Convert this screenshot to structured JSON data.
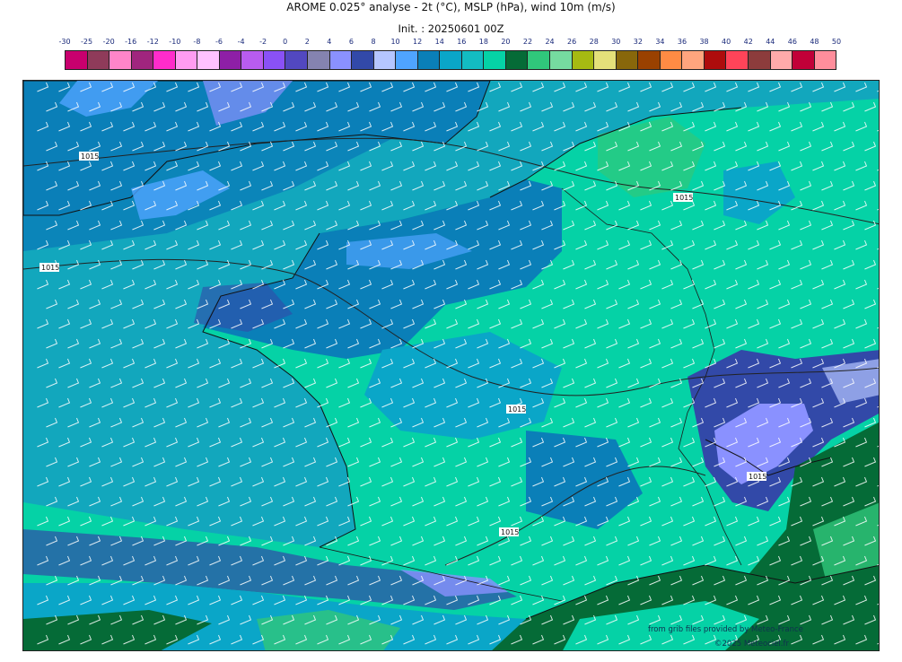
{
  "header": {
    "title": "AROME 0.025° analyse - 2t (°C), MSLP (hPa), wind 10m (m/s)",
    "init": "Init. : 20250601 00Z"
  },
  "legend": {
    "ticks": [
      "-30",
      "-25",
      "-20",
      "-16",
      "-12",
      "-10",
      "-8",
      "-6",
      "-4",
      "-2",
      "0",
      "2",
      "4",
      "6",
      "8",
      "10",
      "12",
      "14",
      "16",
      "18",
      "20",
      "22",
      "24",
      "26",
      "28",
      "30",
      "32",
      "34",
      "36",
      "38",
      "40",
      "42",
      "44",
      "46",
      "48",
      "50"
    ],
    "colors": [
      "#c8006e",
      "#8f3b5a",
      "#ff85c9",
      "#a0257e",
      "#ff2ccb",
      "#ff9cf1",
      "#ffc2ff",
      "#8e1fa6",
      "#b85cf0",
      "#8a51f6",
      "#5248c0",
      "#8583b0",
      "#8a91ff",
      "#3249a8",
      "#b5c6ff",
      "#4fa4ff",
      "#0a7fb8",
      "#0aa6c8",
      "#13bcc2",
      "#05d2a6",
      "#056b37",
      "#30c77b",
      "#76dba0",
      "#a6ba12",
      "#e4e07a",
      "#88670b",
      "#9a4100",
      "#ff8b44",
      "#ffa57e",
      "#ae0c0c",
      "#ff4459",
      "#8c3c3c",
      "#ffaaaa",
      "#c10038",
      "#ff8e9c"
    ]
  },
  "map": {
    "isobar_labels": [
      "1015",
      "1015",
      "1015",
      "1015",
      "1015",
      "1015"
    ],
    "region_colors": {
      "sea": "#12a7bd",
      "warm_land": "#05d2a6",
      "cool_land": "#0a7fb8",
      "cold": "#3249a8",
      "very_warm": "#056b37",
      "mountain_cold": "#8a91ff"
    }
  },
  "footer": {
    "source": "from grib files provided by Meteo-France",
    "copyright": "©2025 Meteociel.fr"
  }
}
